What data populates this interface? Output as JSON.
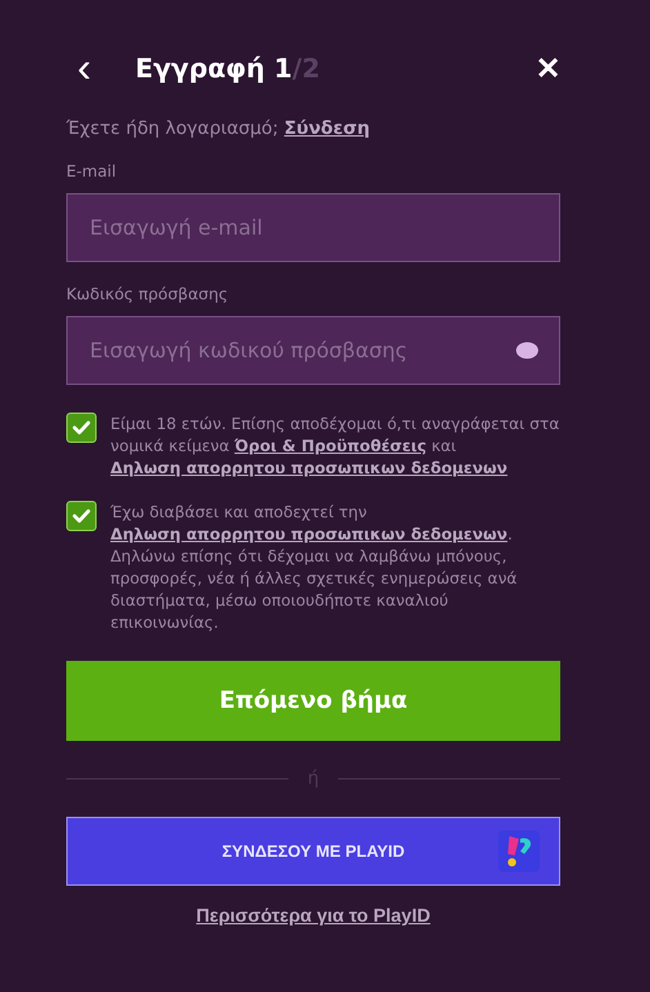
{
  "header": {
    "back": "‹",
    "title": "Εγγραφή 1",
    "step_total": "/2",
    "close": "✕"
  },
  "login_prompt": {
    "text": "Έχετε ήδη λογαριασμό;",
    "link": "Σύνδεση"
  },
  "fields": [
    {
      "label": "E-mail",
      "placeholder": "Εισαγωγή e-mail",
      "kind": "email"
    },
    {
      "label": "Κωδικός πρόσβασης",
      "placeholder": "Εισαγωγή κωδικού πρόσβασης",
      "kind": "password"
    }
  ],
  "consents": [
    {
      "checked": true,
      "parts": [
        {
          "kind": "text",
          "text": "Είμαι 18 ετών. Επίσης αποδέχομαι ό,τι αναγράφεται στα νομικά κείμενα "
        },
        {
          "kind": "link",
          "text": "Όροι & Προϋποθέσεις"
        },
        {
          "kind": "text",
          "text": " και "
        },
        {
          "kind": "link",
          "text": "Δηλωση απορρητου προσωπικων δεδομενων"
        }
      ]
    },
    {
      "checked": true,
      "parts": [
        {
          "kind": "text",
          "text": "Έχω διαβάσει και αποδεχτεί την "
        },
        {
          "kind": "link",
          "text": "Δηλωση απορρητου προσωπικων δεδομενων"
        },
        {
          "kind": "text",
          "text": ". Δηλώνω επίσης ότι δέχομαι να λαμβάνω μπόνους, προσφορές, νέα ή άλλες σχετικές ενημερώσεις ανά διαστήματα, μέσω οποιουδήποτε καναλιού επικοινωνίας."
        }
      ]
    }
  ],
  "next_button": "Επόμενο βήμα",
  "divider": "ή",
  "playid_button": "ΣΥΝΔΕΣΟΥ ΜΕ PLAYID",
  "more_link": "Περισσότερα για το PlayID"
}
